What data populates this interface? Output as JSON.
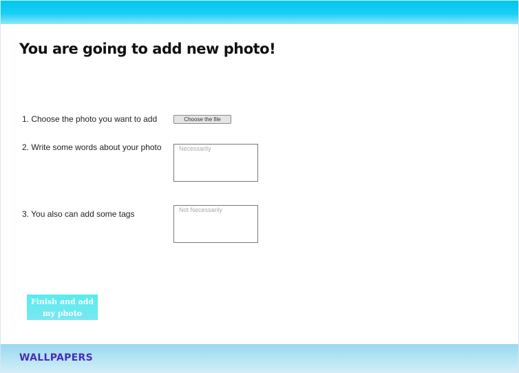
{
  "header": {},
  "page_title": "You are going to add new photo!",
  "form": {
    "step1_label": "1. Choose the photo you want to add",
    "file_button_label": "Choose the file",
    "step2_label": "2. Write some words about your photo",
    "description_placeholder": "Necessarily",
    "step3_label": "3. You also can add some tags",
    "tags_placeholder": "Not Necessarily",
    "finish_label_line1": "Finish and add",
    "finish_label_line2": "my photo"
  },
  "footer": {
    "logo": "WALLPAPERS"
  },
  "colors": {
    "header_bar": "#00c6ef",
    "footer_bar": "#b5e4f4",
    "finish_button": "#6ee9f0",
    "logo": "#4a2db8"
  }
}
